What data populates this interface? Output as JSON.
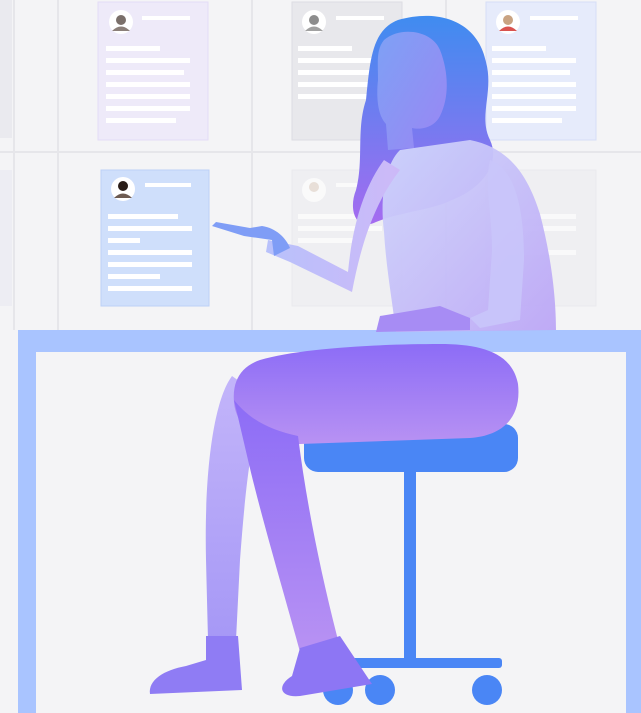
{
  "scene": {
    "description_colors": {
      "background": "#f4f4f6",
      "desk": "#a9c4ff",
      "stool_seat": "#4a86f5",
      "stool_frame": "#4a86f5",
      "hair_top": "#3f8cf0",
      "hair_bottom": "#a56bf0",
      "body_light": "#d7d2fb",
      "body_purple": "#9a6cf5",
      "skin": "#8fa1f7"
    },
    "icons": [
      "profile-card-icon",
      "avatar-icon"
    ]
  }
}
